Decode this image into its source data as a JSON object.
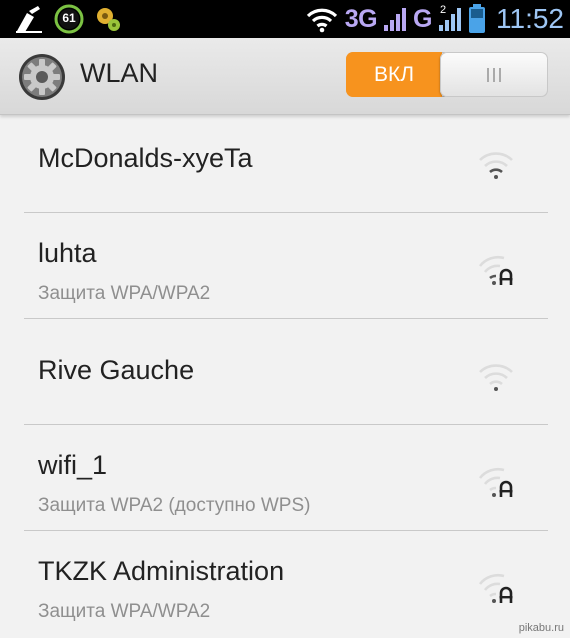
{
  "status_bar": {
    "battery_level": "61",
    "network_3g": "3G",
    "network_g": "G",
    "sim2_label": "2",
    "time": "11:52",
    "icons": [
      "cleanup-broom-icon",
      "battery-saver-icon",
      "puzzle-gear-icon",
      "wifi-icon",
      "signal-icon",
      "battery-icon"
    ]
  },
  "action_bar": {
    "title": "WLAN",
    "toggle_on_label": "ВКЛ",
    "toggle_state": "on",
    "accent_color": "#f7931e"
  },
  "networks": [
    {
      "name": "McDonalds-xyeTa",
      "security": "",
      "secured": false
    },
    {
      "name": "luhta",
      "security": "Защита WPA/WPA2",
      "secured": true
    },
    {
      "name": "Rive Gauche",
      "security": "",
      "secured": false
    },
    {
      "name": "wifi_1",
      "security": "Защита WPA2 (доступно WPS)",
      "secured": true
    },
    {
      "name": "TKZK Administration",
      "security": "Защита WPA/WPA2",
      "secured": true
    }
  ],
  "watermark": "pikabu.ru"
}
